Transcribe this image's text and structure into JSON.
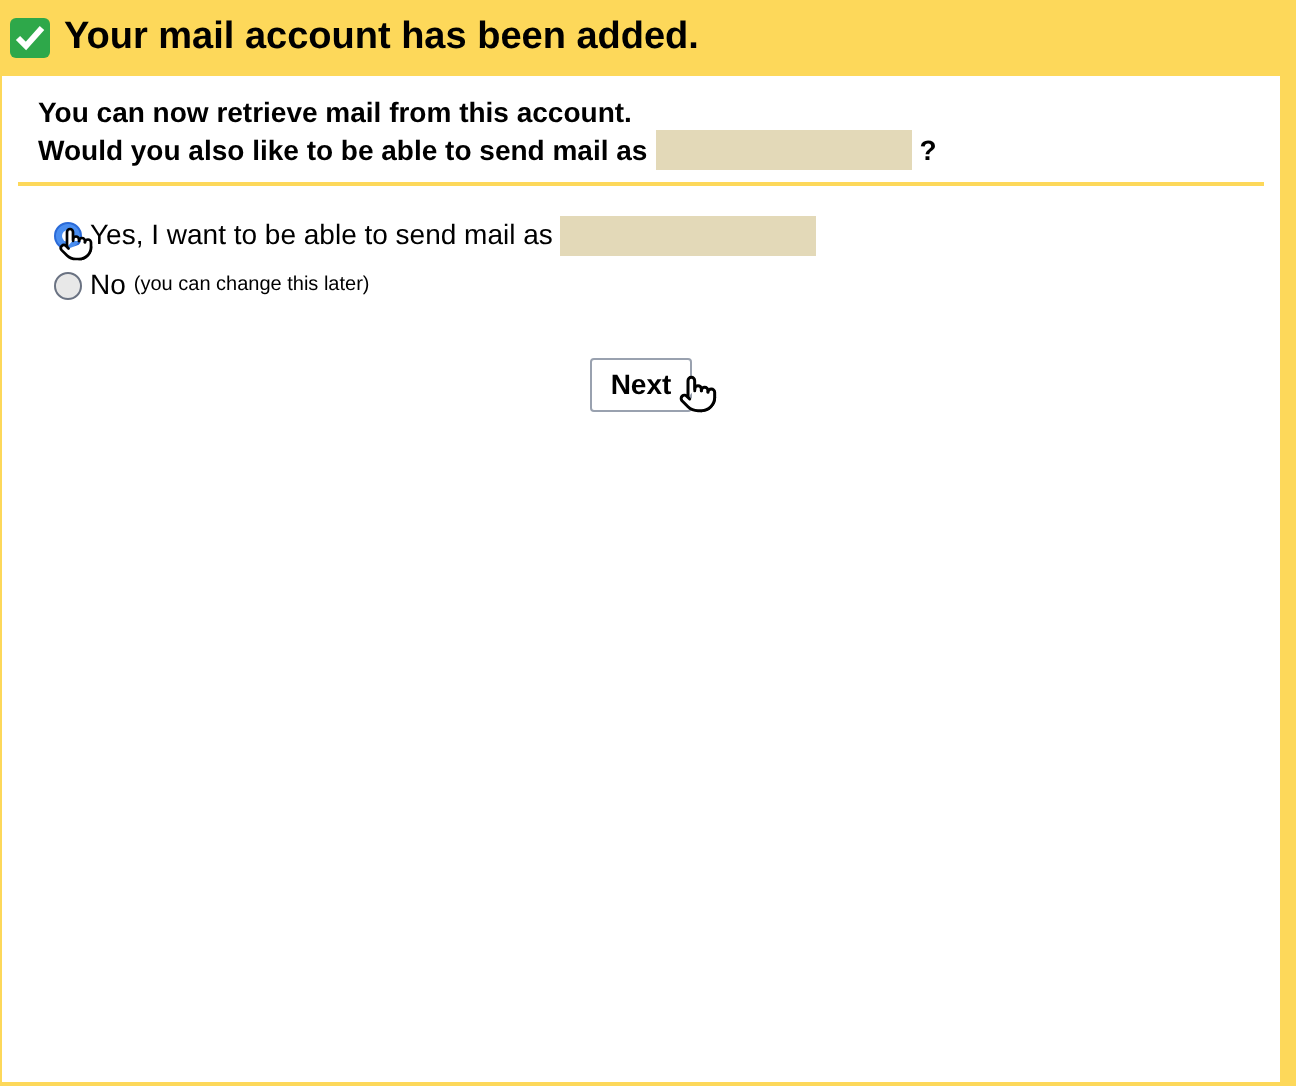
{
  "header": {
    "title": "Your mail account has been added."
  },
  "message": {
    "line_1": "You can now retrieve mail from this account.",
    "line_2": "Would you also like to be able to send mail as",
    "line_2_end": "?"
  },
  "options": [
    {
      "label": "Yes, I want to be able to send mail as",
      "redacted": true,
      "selected": true
    },
    {
      "label": "No",
      "note": "(you can change this later)",
      "redacted": false,
      "selected": false
    }
  ],
  "next_button": {
    "label": "Next"
  }
}
